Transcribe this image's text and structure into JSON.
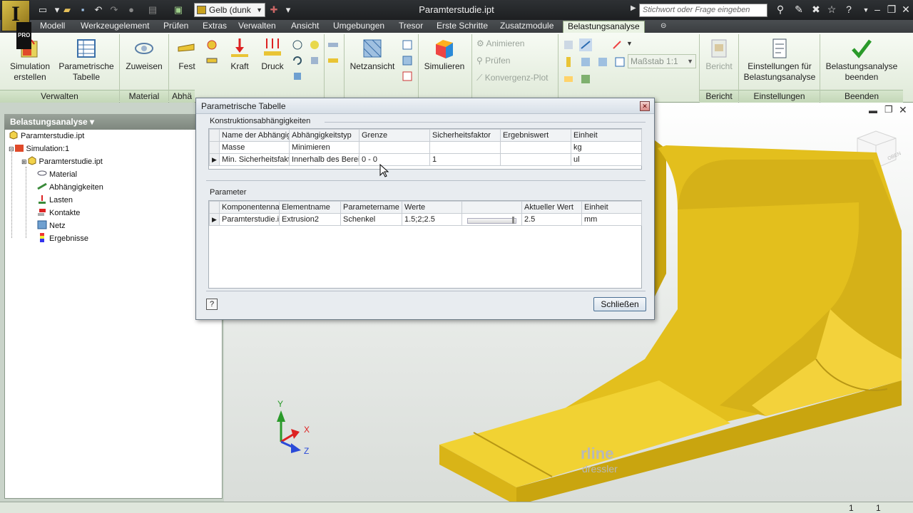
{
  "title_bar": {
    "window_title": "Paramterstudie.ipt",
    "color_dropdown": "Gelb (dunk",
    "search_placeholder": "Stichwort oder Frage eingeben"
  },
  "menu": {
    "tabs": [
      "Modell",
      "Werkzeugelement",
      "Prüfen",
      "Extras",
      "Verwalten",
      "Ansicht",
      "Umgebungen",
      "Tresor",
      "Erste Schritte",
      "Zusatzmodule",
      "Belastungsanalyse"
    ],
    "active_tab": "Belastungsanalyse"
  },
  "ribbon": {
    "sim_create": "Simulation erstellen",
    "param_table": "Parametrische Tabelle",
    "assign": "Zuweisen",
    "fixed": "Fest",
    "force": "Kraft",
    "pressure": "Druck",
    "mesh_view": "Netzansicht",
    "simulate": "Simulieren",
    "animate": "Animieren",
    "check": "Prüfen",
    "convergence": "Konvergenz-Plot",
    "scale": "Maßstab 1:1",
    "report": "Bericht",
    "settings": "Einstellungen für Belastungsanalyse",
    "finish": "Belastungsanalyse beenden",
    "groups": {
      "manage": "Verwalten",
      "material": "Material",
      "constraints": "Abhä",
      "report": "Bericht",
      "settings": "Einstellungen",
      "finish": "Beenden"
    }
  },
  "browser": {
    "header": "Belastungsanalyse ▾",
    "nodes": [
      "Paramterstudie.ipt",
      "Simulation:1",
      "Paramterstudie.ipt",
      "Material",
      "Abhängigkeiten",
      "Lasten",
      "Kontakte",
      "Netz",
      "Ergebnisse"
    ]
  },
  "dialog": {
    "title": "Parametrische Tabelle",
    "constraints_label": "Konstruktionsabhängigkeiten",
    "constraints_headers": [
      "Name der Abhängigk",
      "Abhängigkeitstyp",
      "Grenze",
      "Sicherheitsfaktor",
      "Ergebniswert",
      "Einheit"
    ],
    "constraints_rows": [
      [
        "Masse",
        "Minimieren",
        "",
        "",
        "",
        "kg"
      ],
      [
        "Min. Sicherheitsfakt",
        "Innerhalb des Bereic",
        "0 - 0",
        "1",
        "",
        "ul"
      ]
    ],
    "params_label": "Parameter",
    "params_headers": [
      "Komponentenna",
      "Elementname",
      "Parametername",
      "Werte",
      "",
      "Aktueller Wert",
      "Einheit"
    ],
    "params_rows": [
      [
        "Paramterstudie.ip",
        "Extrusion2",
        "Schenkel",
        "1.5;2;2.5",
        "",
        "2.5",
        "mm"
      ]
    ],
    "help": "?",
    "close": "Schließen"
  },
  "viewport": {
    "axis_x": "X",
    "axis_y": "Y",
    "axis_z": "Z",
    "watermark_1": "rline",
    "watermark_2": "dressler",
    "viewcube_label": "OBEN"
  },
  "status": {
    "left": "1",
    "right": "1"
  },
  "colors": {
    "part": "#e0c020",
    "active_tab": "#e9f2e3"
  }
}
